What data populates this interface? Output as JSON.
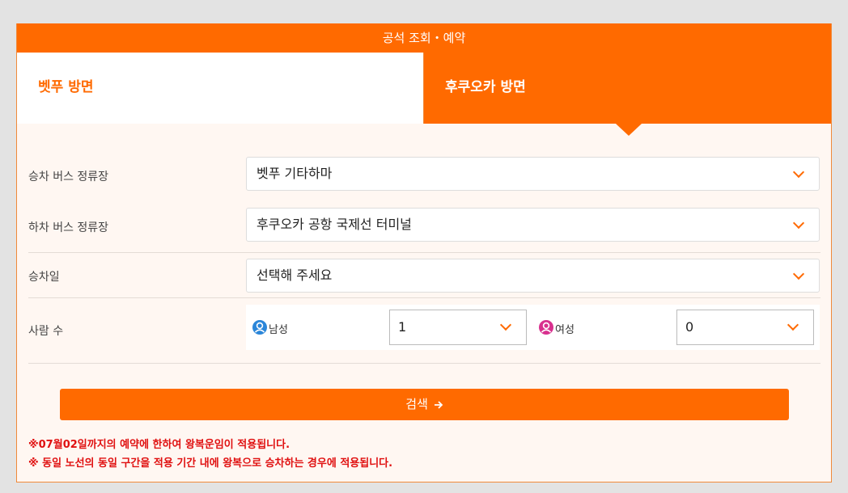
{
  "header": {
    "title": "공석 조회・예약"
  },
  "tabs": [
    {
      "label": "벳푸 방면"
    },
    {
      "label": "후쿠오카 방면"
    }
  ],
  "form": {
    "boarding": {
      "label": "승차 버스 정류장",
      "value": "벳푸 기타하마"
    },
    "alighting": {
      "label": "하차 버스 정류장",
      "value": "후쿠오카 공항 국제선 터미널"
    },
    "date": {
      "label": "승차일",
      "value": "선택해 주세요"
    },
    "people": {
      "label": "사람 수",
      "male": {
        "label": "남성",
        "value": "1"
      },
      "female": {
        "label": "여성",
        "value": "0"
      }
    }
  },
  "search": {
    "label": "검색"
  },
  "notes": [
    "※07월02일까지의 예약에 한하여 왕복운임이 적용됩니다.",
    "※ 동일 노선의 동일 구간을 적용 기간 내에 왕복으로 승차하는 경우에 적용됩니다."
  ],
  "colors": {
    "accent": "#ff6a00",
    "male_icon": "#2b86d9",
    "female_icon": "#d8308e",
    "note_text": "#e01010"
  }
}
